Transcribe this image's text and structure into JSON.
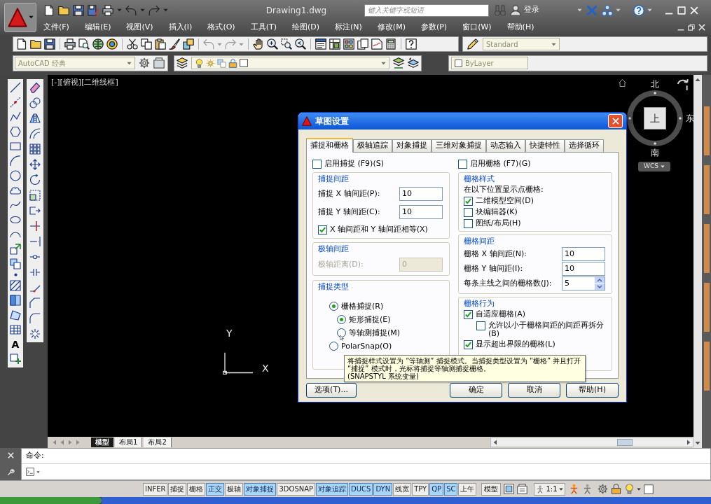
{
  "title_bar": {
    "title": "Drawing1.dwg",
    "search": {
      "placeholder": "键入关键字或短语"
    },
    "sign_in": "登录"
  },
  "menu_bar": [
    "文件(F)",
    "编辑(E)",
    "视图(V)",
    "插入(I)",
    "格式(O)",
    "工具(T)",
    "绘图(D)",
    "标注(N)",
    "修改(M)",
    "参数(P)",
    "窗口(W)",
    "帮助(H)"
  ],
  "toolbars": {
    "text_style": "Standard",
    "workspace": "AutoCAD 经典",
    "property_value": "ByLayer"
  },
  "draw_toolbar": {
    "text_tool": "A"
  },
  "viewport": {
    "label": "[-][俯视][二维线框]",
    "viewcube": {
      "north": "北",
      "face": "上",
      "east": "东",
      "south": "南",
      "coordinate_system": "WCS"
    },
    "ucs": {
      "y_axis": "Y",
      "x_axis": "X"
    }
  },
  "dialog": {
    "title": "草图设置",
    "tabs": [
      {
        "label": "捕捉和栅格",
        "selected": true
      },
      {
        "label": "极轴追踪",
        "selected": false
      },
      {
        "label": "对象捕捉",
        "selected": false
      },
      {
        "label": "三维对象捕捉",
        "selected": false
      },
      {
        "label": "动态输入",
        "selected": false
      },
      {
        "label": "快捷特性",
        "selected": false
      },
      {
        "label": "选择循环",
        "selected": false
      }
    ],
    "snap_enabled": {
      "label": "启用捕捉 (F9)(S)",
      "checked": false
    },
    "snap_spacing": {
      "title": "捕捉间距",
      "fields": [
        {
          "label": "捕捉 X 轴间距(P):",
          "value": "10"
        },
        {
          "label": "捕捉 Y 轴间距(C):",
          "value": "10"
        }
      ],
      "equal": {
        "label": "X 轴间距和 Y 轴间距相等(X)",
        "checked": true
      }
    },
    "polar_spacing": {
      "title": "极轴间距",
      "label": "极轴距离(D):",
      "value": "0",
      "disabled": true
    },
    "snap_type": {
      "title": "捕捉类型",
      "options": [
        {
          "label": "栅格捕捉(R)",
          "selected": true,
          "children": [
            {
              "label": "矩形捕捉(E)",
              "selected": true
            },
            {
              "label": "等轴测捕捉(M)",
              "selected": false
            }
          ]
        },
        {
          "label": "PolarSnap(O)",
          "selected": false
        }
      ]
    },
    "grid_enabled": {
      "label": "启用栅格 (F7)(G)",
      "checked": false
    },
    "grid_style": {
      "title": "栅格样式",
      "caption": "在以下位置显示点栅格:",
      "options": [
        {
          "label": "二维模型空间(D)",
          "checked": true
        },
        {
          "label": "块编辑器(K)",
          "checked": false
        },
        {
          "label": "图纸/布局(H)",
          "checked": false
        }
      ]
    },
    "grid_spacing": {
      "title": "栅格间距",
      "fields": [
        {
          "label": "栅格 X 轴间距(N):",
          "value": "10",
          "kind": "text"
        },
        {
          "label": "栅格 Y 轴间距(I):",
          "value": "10",
          "kind": "text"
        },
        {
          "label": "每条主线之间的栅格数(J):",
          "value": "5",
          "kind": "spinner"
        }
      ]
    },
    "grid_behavior": {
      "title": "栅格行为",
      "options": [
        {
          "label": "自适应栅格(A)",
          "checked": true,
          "children": [
            {
              "label": "允许以小于栅格间距的间距再拆分(B)",
              "checked": false
            }
          ]
        },
        {
          "label": "显示超出界限的栅格(L)",
          "checked": true
        }
      ]
    },
    "tooltip": {
      "text": "将捕捉样式设置为 “等轴测” 捕捉模式。当捕捉类型设置为 “栅格” 并且打开 “捕捉” 模式时，光标将捕捉等轴测捕捉栅格。",
      "note": "(SNAPSTYL 系统变量)"
    },
    "options_button": "选项(T)...",
    "buttons": [
      "确定",
      "取消",
      "帮助(H)"
    ]
  },
  "layout_tabs": [
    {
      "label": "模型",
      "selected": true
    },
    {
      "label": "布局1",
      "selected": false
    },
    {
      "label": "布局2",
      "selected": false
    }
  ],
  "command_line": {
    "history": "命令:"
  },
  "status_bar": {
    "toggles": [
      {
        "label": "INFER",
        "on": false
      },
      {
        "label": "捕捉",
        "on": false
      },
      {
        "label": "栅格",
        "on": false
      },
      {
        "label": "正交",
        "on": true
      },
      {
        "label": "极轴",
        "on": false
      },
      {
        "label": "对象捕捉",
        "on": true
      },
      {
        "label": "3DOSNAP",
        "on": false
      },
      {
        "label": "对象追踪",
        "on": true
      },
      {
        "label": "DUCS",
        "on": true
      },
      {
        "label": "DYN",
        "on": true
      },
      {
        "label": "线宽",
        "on": false
      },
      {
        "label": "TPY",
        "on": false
      },
      {
        "label": "QP",
        "on": true
      },
      {
        "label": "SC",
        "on": true
      },
      {
        "label": "上午",
        "on": false
      }
    ],
    "space": "模型",
    "annotation_scale": "1:1"
  }
}
